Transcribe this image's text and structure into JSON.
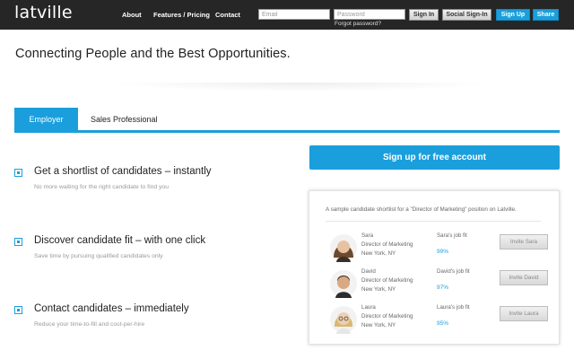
{
  "header": {
    "logo": "latville",
    "nav": {
      "about": "About",
      "features": "Features / Pricing",
      "contact": "Contact"
    },
    "email_placeholder": "Email",
    "password_placeholder": "Password",
    "forgot_password": "Forgot password?",
    "sign_in": "Sign In",
    "social_sign_in": "Social Sign-In",
    "sign_up": "Sign Up",
    "share": "Share"
  },
  "hero": {
    "headline": "Connecting People and the Best Opportunities."
  },
  "tabs": [
    {
      "label": "Employer",
      "active": true
    },
    {
      "label": "Sales Professional",
      "active": false
    }
  ],
  "features": [
    {
      "title": "Get a shortlist of candidates – instantly",
      "subtitle": "No more waiting for the right candidate to find you"
    },
    {
      "title": "Discover candidate fit – with one click",
      "subtitle": "Save time by pursuing qualified candidates only"
    },
    {
      "title": "Contact candidates – immediately",
      "subtitle": "Reduce your time-to-fill and cost-per-hire"
    }
  ],
  "cta": {
    "label": "Sign up for free account"
  },
  "shortlist": {
    "title": "A sample candidate shortlist for a \"Director of Marketing\" position on Latville.",
    "candidates": [
      {
        "name": "Sara",
        "role": "Director of Marketing",
        "location": "New York, NY",
        "fit_label": "Sara's job fit",
        "fit": "99%",
        "invite": "Invite Sara"
      },
      {
        "name": "David",
        "role": "Director of Marketing",
        "location": "New York, NY",
        "fit_label": "David's job fit",
        "fit": "97%",
        "invite": "Invite David"
      },
      {
        "name": "Laura",
        "role": "Director of Marketing",
        "location": "New York, NY",
        "fit_label": "Laura's job fit",
        "fit": "95%",
        "invite": "Invite Laura"
      }
    ]
  },
  "colors": {
    "accent": "#1a9fdc",
    "topbar": "#262626"
  }
}
